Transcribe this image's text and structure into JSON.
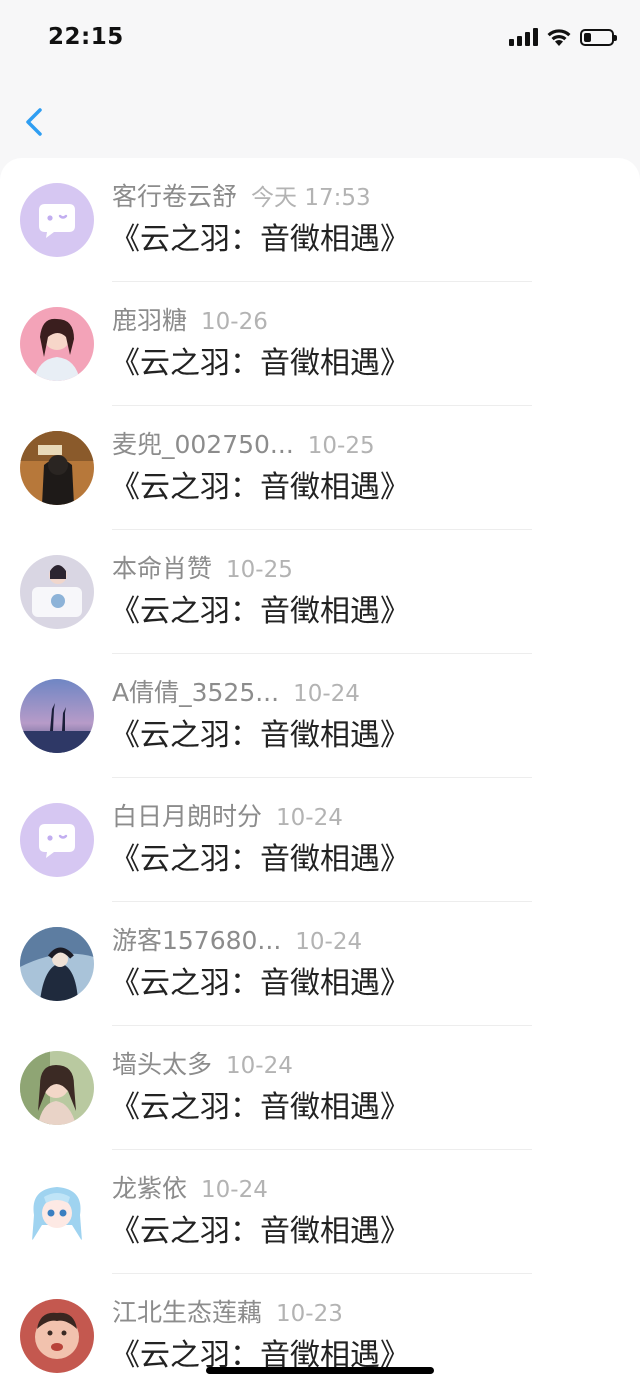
{
  "status_bar": {
    "time": "22:15",
    "icons": [
      "signal-icon",
      "wifi-icon",
      "battery-icon"
    ]
  },
  "nav": {
    "back_icon": "chevron-left-icon",
    "accent_color": "#2f9ef2"
  },
  "messages": [
    {
      "name": "客行卷云舒",
      "time": "今天 17:53",
      "text": "《云之羽：音徵相遇》",
      "avatar": "default-chat-avatar-icon"
    },
    {
      "name": "鹿羽糖",
      "time": "10-26",
      "text": "《云之羽：音徵相遇》",
      "avatar": "user-photo-avatar"
    },
    {
      "name": "麦兜_002750...",
      "time": "10-25",
      "text": "《云之羽：音徵相遇》",
      "avatar": "user-photo-avatar"
    },
    {
      "name": "本命肖赞",
      "time": "10-25",
      "text": "《云之羽：音徵相遇》",
      "avatar": "user-photo-avatar"
    },
    {
      "name": "A倩倩_3525...",
      "time": "10-24",
      "text": "《云之羽：音徵相遇》",
      "avatar": "user-photo-avatar"
    },
    {
      "name": "白日月朗时分",
      "time": "10-24",
      "text": "《云之羽：音徵相遇》",
      "avatar": "default-chat-avatar-icon"
    },
    {
      "name": "游客157680...",
      "time": "10-24",
      "text": "《云之羽：音徵相遇》",
      "avatar": "user-photo-avatar"
    },
    {
      "name": "墙头太多",
      "time": "10-24",
      "text": "《云之羽：音徵相遇》",
      "avatar": "user-photo-avatar"
    },
    {
      "name": "龙紫依",
      "time": "10-24",
      "text": "《云之羽：音徵相遇》",
      "avatar": "user-photo-avatar"
    },
    {
      "name": "江北生态莲藕",
      "time": "10-23",
      "text": "《云之羽：音徵相遇》",
      "avatar": "user-photo-avatar"
    }
  ],
  "colors": {
    "name_gray": "#8c8c8c",
    "time_gray": "#b3b3b3",
    "message_text": "#222222",
    "default_avatar_bg": "#d6c7f2"
  }
}
